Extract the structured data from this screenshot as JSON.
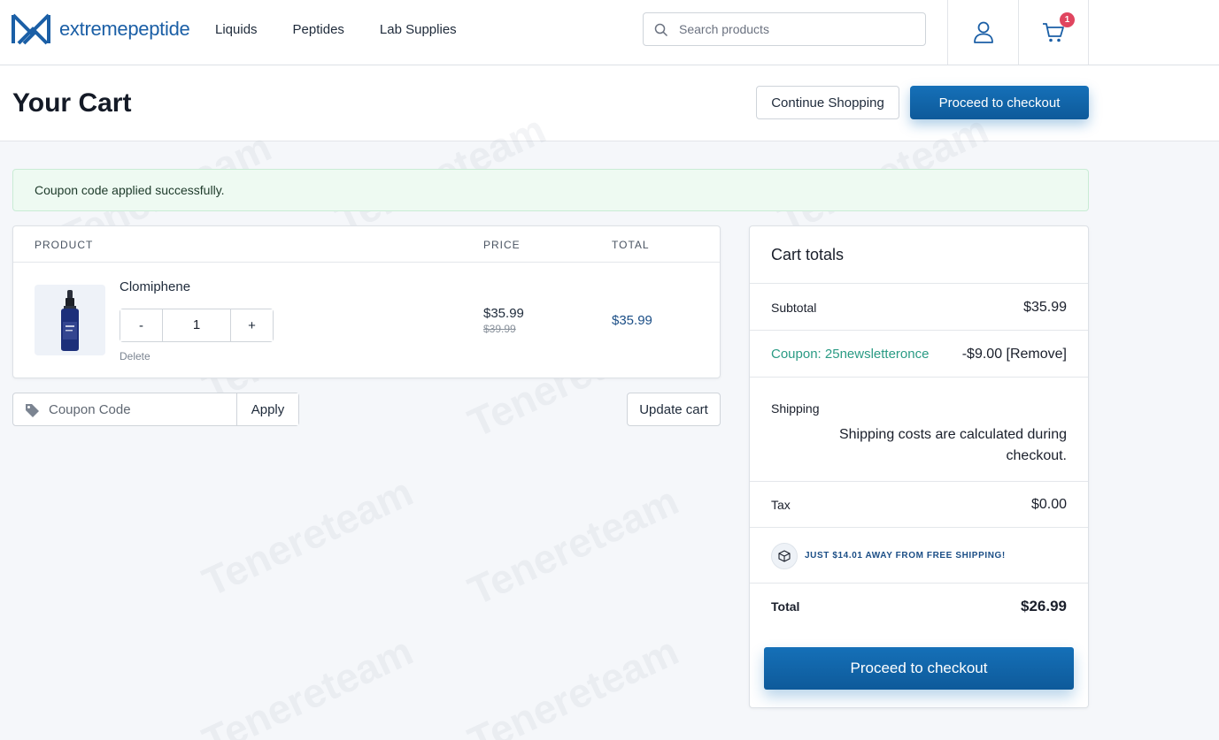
{
  "brand": {
    "name": "extremepeptide",
    "color": "#1b5fa6"
  },
  "nav": {
    "items": [
      "Liquids",
      "Peptides",
      "Lab Supplies"
    ]
  },
  "search": {
    "placeholder": "Search products"
  },
  "header": {
    "cart_count": "1"
  },
  "page": {
    "title": "Your Cart",
    "continue_label": "Continue Shopping",
    "checkout_label": "Proceed to checkout"
  },
  "alert": {
    "message": "Coupon code applied successfully."
  },
  "cart_table": {
    "headers": [
      "PRODUCT",
      "PRICE",
      "TOTAL"
    ],
    "items": [
      {
        "name": "Clomiphene",
        "quantity": "1",
        "minus": "-",
        "plus": "+",
        "delete_label": "Delete",
        "price": "$35.99",
        "price_old": "$39.99",
        "total": "$35.99"
      }
    ]
  },
  "coupon": {
    "placeholder": "Coupon Code",
    "apply_label": "Apply"
  },
  "update_label": "Update cart",
  "totals": {
    "title": "Cart totals",
    "subtotal_label": "Subtotal",
    "subtotal_value": "$35.99",
    "coupon_label": "Coupon: 25newsletteronce",
    "coupon_value": "-$9.00 [Remove]",
    "shipping_label": "Shipping",
    "shipping_note": "Shipping costs are calculated during checkout.",
    "tax_label": "Tax",
    "tax_value": "$0.00",
    "free_shipping": "JUST $14.01 AWAY FROM FREE SHIPPING!",
    "total_label": "Total",
    "total_value": "$26.99",
    "checkout_label": "Proceed to checkout"
  },
  "watermark": "Tenereteam",
  "colors": {
    "primary": "#1570b8",
    "accent_green": "#2a9b84",
    "badge": "#e0455f"
  }
}
